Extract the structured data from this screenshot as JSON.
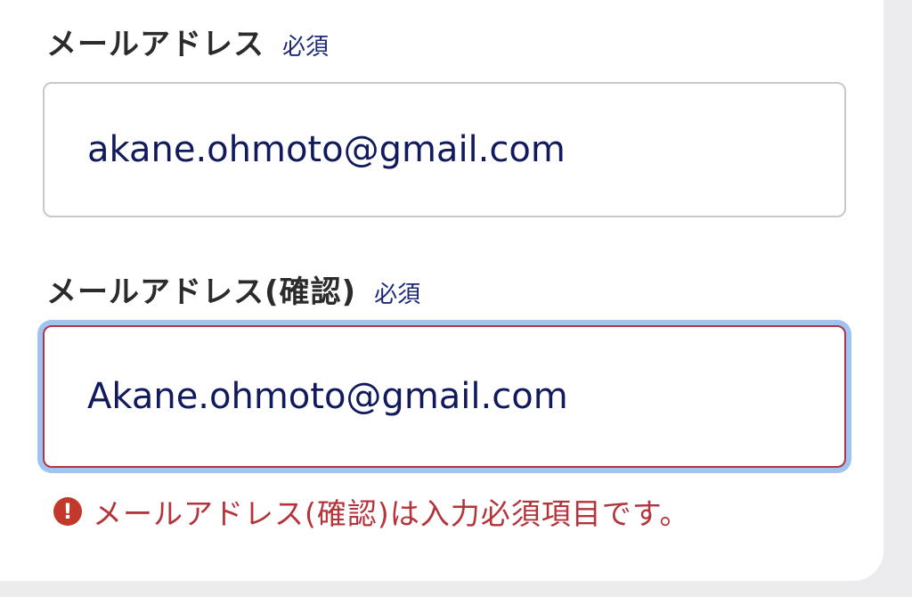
{
  "email": {
    "label": "メールアドレス",
    "required": "必須",
    "value": "akane.ohmoto@gmail.com"
  },
  "email_confirm": {
    "label": "メールアドレス(確認)",
    "required": "必須",
    "value": "Akane.ohmoto@gmail.com",
    "error_message": "メールアドレス(確認)は入力必須項目です。",
    "error_icon_glyph": "!"
  },
  "colors": {
    "input_text": "#101a5c",
    "required_badge": "#1c2a78",
    "error": "#b5333a",
    "focus_ring": "#9fc4f0"
  }
}
